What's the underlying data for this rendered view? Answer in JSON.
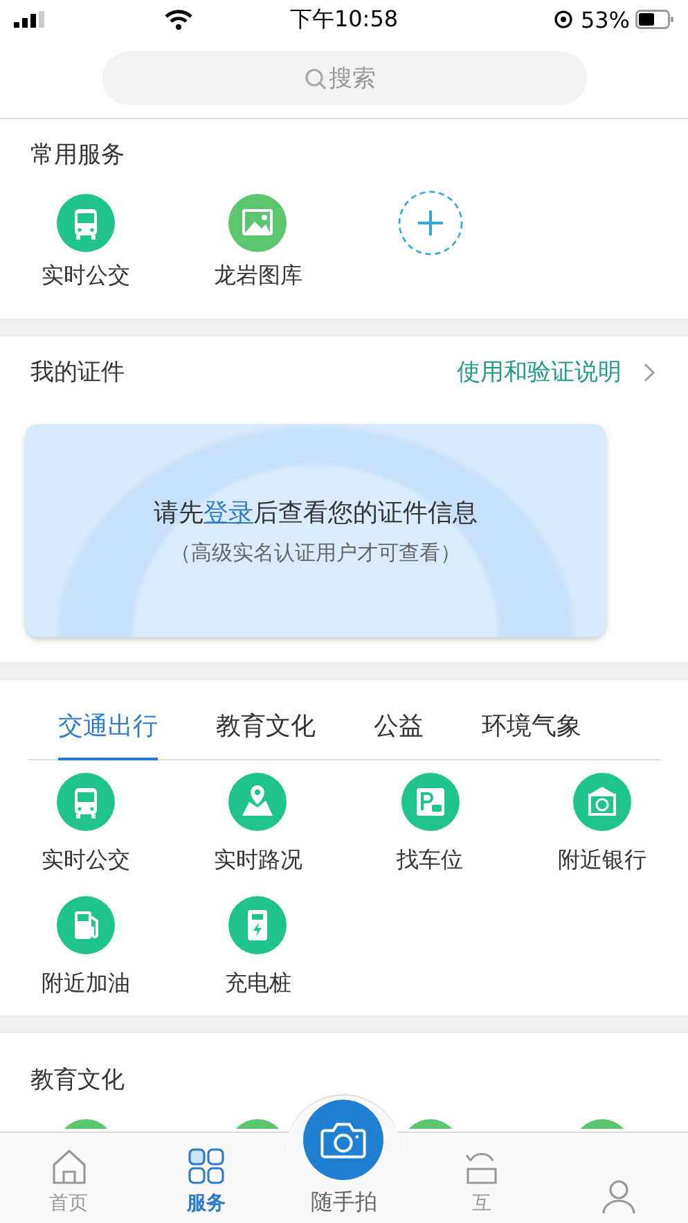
{
  "status_bar": {
    "time": "下午10:58",
    "battery": "53%"
  },
  "search": {
    "placeholder": "搜索"
  },
  "common_services": {
    "title": "常用服务",
    "items": [
      {
        "label": "实时公交",
        "kind": "bus"
      },
      {
        "label": "龙岩图库",
        "kind": "gallery"
      }
    ]
  },
  "my_documents": {
    "title": "我的证件",
    "link": "使用和验证说明",
    "prompt_before": "请先",
    "login_link": "登录",
    "prompt_after": "后查看您的证件信息",
    "note": "（高级实名认证用户才可查看）"
  },
  "category_tabs": [
    {
      "label": "交通出行",
      "selected": true
    },
    {
      "label": "教育文化",
      "selected": false
    },
    {
      "label": "公益",
      "selected": false
    },
    {
      "label": "环境气象",
      "selected": false
    }
  ],
  "services": [
    {
      "label": "实时公交",
      "kind": "bus"
    },
    {
      "label": "实时路况",
      "kind": "map"
    },
    {
      "label": "找车位",
      "kind": "parking"
    },
    {
      "label": "附近银行",
      "kind": "bank"
    },
    {
      "label": "附近加油",
      "kind": "fuel"
    },
    {
      "label": "充电桩",
      "kind": "charger"
    }
  ],
  "next_section": {
    "title": "教育文化"
  },
  "bottom_nav": [
    {
      "label": "首页",
      "kind": "home",
      "selected": false
    },
    {
      "label": "服务",
      "kind": "grid",
      "selected": true
    },
    {
      "label": "随手拍",
      "kind": "camera",
      "selected": false
    },
    {
      "label": "互",
      "kind": "refresh",
      "selected": false
    },
    {
      "kind": "user",
      "selected": false
    }
  ]
}
